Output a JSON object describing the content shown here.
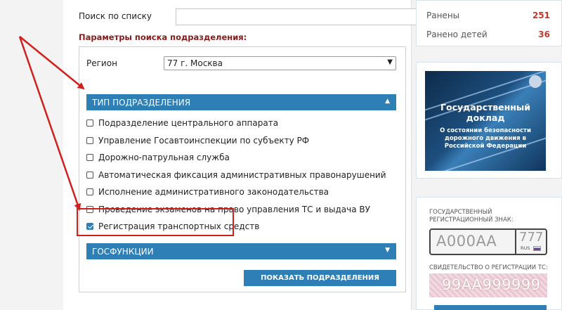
{
  "search": {
    "label": "Поиск по списку",
    "value": "",
    "placeholder": ""
  },
  "params_title": "Параметры поиска подразделения:",
  "region": {
    "label": "Регион",
    "selected": "77 г. Москва"
  },
  "type_section": {
    "title": "ТИП ПОДРАЗДЕЛЕНИЯ",
    "arrow_icon": "chevron-up-icon",
    "items": [
      {
        "label": "Подразделение центрального аппарата",
        "checked": false
      },
      {
        "label": "Управление Госавтоинспекции по субъекту РФ",
        "checked": false
      },
      {
        "label": "Дорожно-патрульная служба",
        "checked": false
      },
      {
        "label": "Автоматическая фиксация административных правонарушений",
        "checked": false
      },
      {
        "label": "Исполнение административного законодательства",
        "checked": false
      },
      {
        "label": "Проведение экзаменов на право управления ТС и выдача ВУ",
        "checked": false
      },
      {
        "label": "Регистрация транспортных средств",
        "checked": true
      }
    ]
  },
  "func_section": {
    "title": "ГОСФУНКЦИИ",
    "arrow_icon": "chevron-down-icon"
  },
  "show_button": "ПОКАЗАТЬ ПОДРАЗДЕЛЕНИЯ",
  "stats": [
    {
      "label": "Ранены",
      "value": "251"
    },
    {
      "label": "Ранено детей",
      "value": "36"
    }
  ],
  "report": {
    "title": "Государственный доклад",
    "subtitle": "О состоянии безопасности дорожного движения в Российской Федерации"
  },
  "plate": {
    "label": "ГОСУДАРСТВЕННЫЙ РЕГИСТРАЦИОННЫЙ ЗНАК:",
    "number": "А000АА",
    "region": "777",
    "country": "RUS"
  },
  "certificate": {
    "label": "СВИДЕТЕЛЬСТВО О РЕГИСТРАЦИИ ТС:",
    "number": "99АА999999"
  },
  "colors": {
    "accent": "#2e7fb6",
    "annotation": "#d0201e",
    "params_title": "#8a1a1a",
    "stat_value": "#c0392b"
  }
}
